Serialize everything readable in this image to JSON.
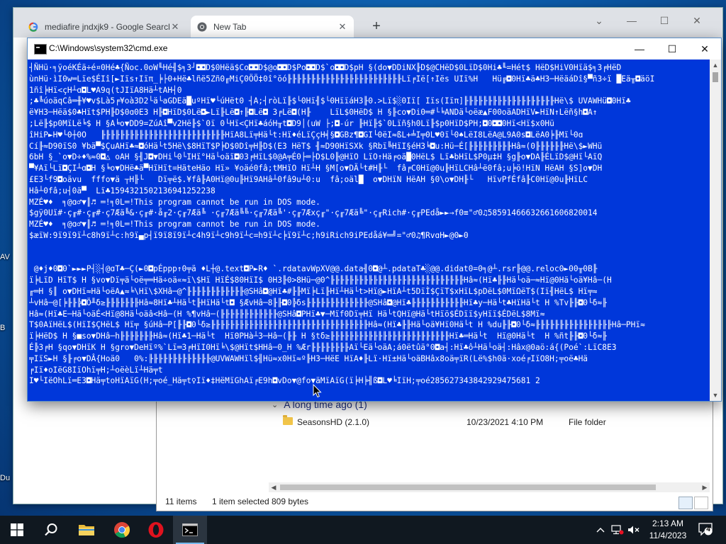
{
  "desktop": {
    "fragments": [
      "AV",
      "B",
      "Du"
    ]
  },
  "browser": {
    "tabs": [
      {
        "title": "mediafire jndxjk9 - Google Search",
        "icon": "google-icon",
        "active": false
      },
      {
        "title": "New Tab",
        "icon": "chrome-icon",
        "active": true
      }
    ],
    "controls": {
      "tab_search": "⌄",
      "minimize": "—",
      "maximize": "☐",
      "close": "✕"
    },
    "new_tab_label": "+"
  },
  "explorer": {
    "group_header": "A long time ago (1)",
    "file": {
      "name": "SeasonsHD (2.1.0)",
      "date": "10/23/2021 4:10 PM",
      "type": "File folder"
    },
    "status": {
      "items": "11 items",
      "selected": "1 item selected",
      "size": "809 bytes"
    }
  },
  "cmd": {
    "title": "C:\\Windows\\system32\\cmd.exe",
    "controls": {
      "minimize": "—",
      "maximize": "☐",
      "close": "✕"
    },
    "bg_color": "#0037da",
    "fg_color": "#ffffff",
    "output": "┤ÑHü·╕ÿoéKÉä÷é¤0Hé♣{Ñoc.0oW╙Hé╢$╕3┘◘◘D$0Hëä$Co◘◘D$@o◘◘D$Po◘◘D$`o◘◘D$pH §(do▼DDiNX╟D$@CHëD$0LïD$0Hi♣╙=Hét$ HëD$HiV0Hïä$╕3╒HëD\nùnHü·ìI0w═Lïe$ÉIî[►Iïs↑Iïπ_╞├0+Hë♣lñë5Zñ0╓MiÇ0ÖÖ‡0î°ŏó╟╟╟╟╟╟╟╟╟╟╟╟╟╟╟╟╟╟╟╟╟╟╟╟Lï╒Ië[↑Iës UIï%H   Hü╔◘0Hï♣ä♣H3─HëäáDî§▀ñ3÷ï █Eä╥◘äöI\n1ñî╞Hï<çH┴ɑ◘L♥A9q(tJIïA8Hä┴tAH┤0\n;♣╚úoäqCâ═╫¥♥v$Là5╒¥oà3D2└ä└aGDEä█uºHï♥└úHët0 ┤A;┤ròLï╟$└0Hï╢$└0HïïáH3╟0.>Lï$░0Iï[ Iïs(Iïπ]╟╟╟╟╟╟╟╟╟╟╟╟╟╟╟╟╟╟╟Hë\\$ UVAWHü◘0Hï♣\në¥H3─Hëä$0♣Hït$PH╟D$0ɑ0E3 H╟◘HïD$0Lë◘►Lï╟Lë◘↑╟◘Lë◘ 3╒Lë◘(H╟    LïL$0HëD$ H §╟co▼Di0═#└╘ANDä└oëæ▲F00oäADHïV►HïN↑Lëñ§h◘A↑\n;Lë╟$p0MïLë╘$ H §A╘o▼DD9=ZúAî▀v2Hë╟$`0ï 0└Hï<ÇHï♣áóH╥t◘D9│(uW ├;◘-úr ╟Hï╟$`0Lïñ§h0Lï╟$p0HïD$PH;◘0◘◘0Hï<Hï$x0Hü\nîHiP►H♥└0┼0O   ╟╟╟╟╟╟╟╟╟╟╟╟╟╟╟╟╟╟╟╟╟╟╟╟╟╟HïA8Lï╤Hä└t:Hï♦éLïÇçH╡§◘GBz¶◘GI└0ëI≈ßL+╧I╤0L♥0ï└0♠LëI8LëA@L9A0s◘LëA0╞╟Mï└0ɑ\nCí╟≈D90ïS0 ¥bä▀$ÇuAHï♣≈◘óHä└t5Hë\\$8HïT$P╞D$0Dî╤H╟D$(E3 HëT$ ╢≈D90HïSXk §Rbï╚HïI§éH3╘◘u:Hü─É[╟╟╟╟╟╟╟╟╟Hâ≈(0╟╟╟╟╟╟Hë\\$►WHü\n6bH §_`o▼D÷♦%≈0◘△ oAH §╢J◘▼DHi└0└IHï°Hä└oäï◘03╒HïL$0@A╤É0├═├D$L0╟@HïO LïO↑Hä╒oä█0HëL$ Lï♣bHïL$P0µ‡H §g╟o▼DA╟ÉLïD$@Hï└AïQ\n▀¥Aï└Lï◘ÇI┴ɑ◘H §╘o▼DHë♣ä▀HïHït=HäteHäo Hï» ¥oäé0fâ;tMHïO Hï┴H §M[o▼DÄ└t#H╟└  fâ╒C0Hï@0u╟HïLCHâ┴ë0fâ;u╞ö!HïN HëAH §S]o▼DH\n£E3└f9◘oävu  fffo▼ä ┬H╟└   Dï╤ë$.¥fâ╟A0Hï@0u╟Hï9AHâ┴0fâ9u┴0:u  fâ;oäl█  o▼DHïN HëAH §0\\o▼DH╟└   HïvPfÉfâ╟C0Hï@0u╟HïLC\nHâ┴0fâ;u┤0ä▀  Lï♣1594321502136941252238\nMZÉ♥♦  ╕@ɑ♂▼║♬ ═!╕0L═!This program cannot be run in DOS mode.\n$gÿ0Uï#·ç╓#·ç╓#·ç7Æä╚&·ç╓#·å╓2·ç╓7Æä╚ ·ç╓7Æä╚╚·ç╓7Æä╚'·ç╓7Æxç╓\"·ç╓7Æä╚\"·ç╓Rich#·ç╓PEdå►►→f0≡\"♂0♫58591466632661606820014\nMZÉ♥♦  ╕@ɑ♂▼║♬ ═!╕0L═!This program cannot be run in DOS mode.\n$æïW:9ï9ï9ï┴c8h9ï┴c:h9ï▄p┤ï9ï8ï9ï┴c4h9ï┴c9h9ï┴c=h9ï┴c╞ï9ï┴c;h9iRich9iPEdåá¥═╝=\"♂0♫¶RvɑH►@0►0\n\n\n @♦j♦0◘0`►►►P┤░┤@ɑT♣─Ç(►0◘pÉppp↑0╤ä ♦L┼@.text◘P►R♦ `.rdatavWpXV@@.data╢0◘@┴.pdataT♣░@@.didat0=0╕@┴.rsr╟@@.reloc0►00╥0B╟\nï╞LïD HïT$ H §vo▼Dï╤ä└oë╤═Hä÷oä«≈ï\\$Hï HïÉ$80HïI$ 0H3╟0>8Hü─@0^╟╟╟╟╟╟╟╟╟╟╟╟╟╟╟╟╟╟╟╟╟╟╟╟╟╟╟╟Hâ≈(Hï♣╟╟Hä└oä─≈Hï@0Hä└oä¥Hâ─(H\n╓═H §║ o▼DHï≈Hä└oëA▲≈╘\\Hï\\$XHâ─@^╟╟╟╟╟╟╟╟╟╟╟╟@SHâ◘@Hï♣#╟╟Mï╞Lï╟Hï┴Hä└t>Hï@►HïA┴t5DïÌ$ÇïT$xHïL$pDëL$0MïΩëT$(Iï╢HëL$ Hï╤≈\n┴vHâ─@[╞╟╟╠◘Ö╨δ≥╟╟╟╟╟╟╟Hâ≈8Hï♣┴Hä└t╟HïHä└t◘ §ÆvHâ─8╟╟◘0╠δs╟╟╟╟╟╟╟╟╟╟╟╟╟@SHâ◘@Hï♣╟╟╟╟╟╟╟╟╟╟╟Hï♣y─Hä└t♣HïHä└t H %Tv╟╟◘0└δ≈╟\nHâ≈(Hï♣E─Hä└oäÉ<Hï@8Hä└oäâ<Hâ─(H %¶vHâ─(╟╟╟╟╟╟╟╟╟╟╟╟@SHâ◘PHï♣▼─Mïf0Dï╤Hï Hä└tQHï@Hä└tHïö$ÉDïï$yHïï$ÉDëL$8Mï≈\nT$0AïHëL$(HïI$ÇHëL$ Hï╤ §úHâ─P[╟╟◘0└δ≥╟╟╟╟╟╟╟╟╟╟╟╟╟╟╟╟╟╟╟╟╟╟╟╟╟╟╟╟╟╟╟╟╟Hâ≈(Hï♣╟╟Hä└oä¥Hï0Hä└t H %du╟╟◘0└δ≈╟╟╟╟╟╟╟╟╟╟╟╟╟╟╟╟Hâ─PHï≈\nï╞HëD$ H §■so▼DHâ─h╟╟╟╟╟╟╟Hâ≈(Hï♣1─Hä└t  HïΘPHà┴3─Hâ─(╟╟ H §tδ≥╟╟╟╟╟╟╟╟╟╟╟╟╟╟╟╟╟╟╟╟╟╟╟╟╟Hï♣═Hä└t  Hï@0Hä└t  H %ñt╟╟◘0└δ≈╟\nÉ╠3╒H §qo▼DHïK H §gro▼DeHïº%`Lï═3╒HïI0Hï╘\\$@Hït$HHâ─0_H %Ær╟╟╟╟╟╟╟╟Aï└Eä└oäA;á0ëtûä°0◘a┤:Hï♣ô┴Hä└oä┤:Hâx@0aö:á{(Poé`:LïC8E3\n╤IïS►H §╟╒o▼DÂ{Hoä0   0%:╟╟╟╟╟╟╟╟╟╟╟╟╟@UVWAWHïl$╢Hü≈x0Hï≈º╟H3─HëE HïA♦╟Lï·Hï±Hä└oäBHâx8oä╤ïR(Lë%$h0ä·xoé╒IïO8H;╤oë♣Hä\n╒Iï♦oIëG8IïOhï╤H;┴oëèLï┴Hä╤t\nI♥└IëOhLï═E3◘Hä╤toHïAïG(H;╤oé_Hä╤t♀Iï♦‡HëMïGhAï╒E9h◘vDo▼@fo▼äMïAïG(ï╞H╞╢ß◘L♥╘IïH;╤oé285627343842929475681 2"
  },
  "taskbar": {
    "items": [
      {
        "name": "start-button"
      },
      {
        "name": "search-button"
      },
      {
        "name": "file-explorer-app"
      },
      {
        "name": "chrome-app"
      },
      {
        "name": "opera-app"
      },
      {
        "name": "cmd-app"
      }
    ],
    "clock": {
      "time": "2:13 AM",
      "date": "11/4/2023"
    },
    "notification_count": "4"
  }
}
